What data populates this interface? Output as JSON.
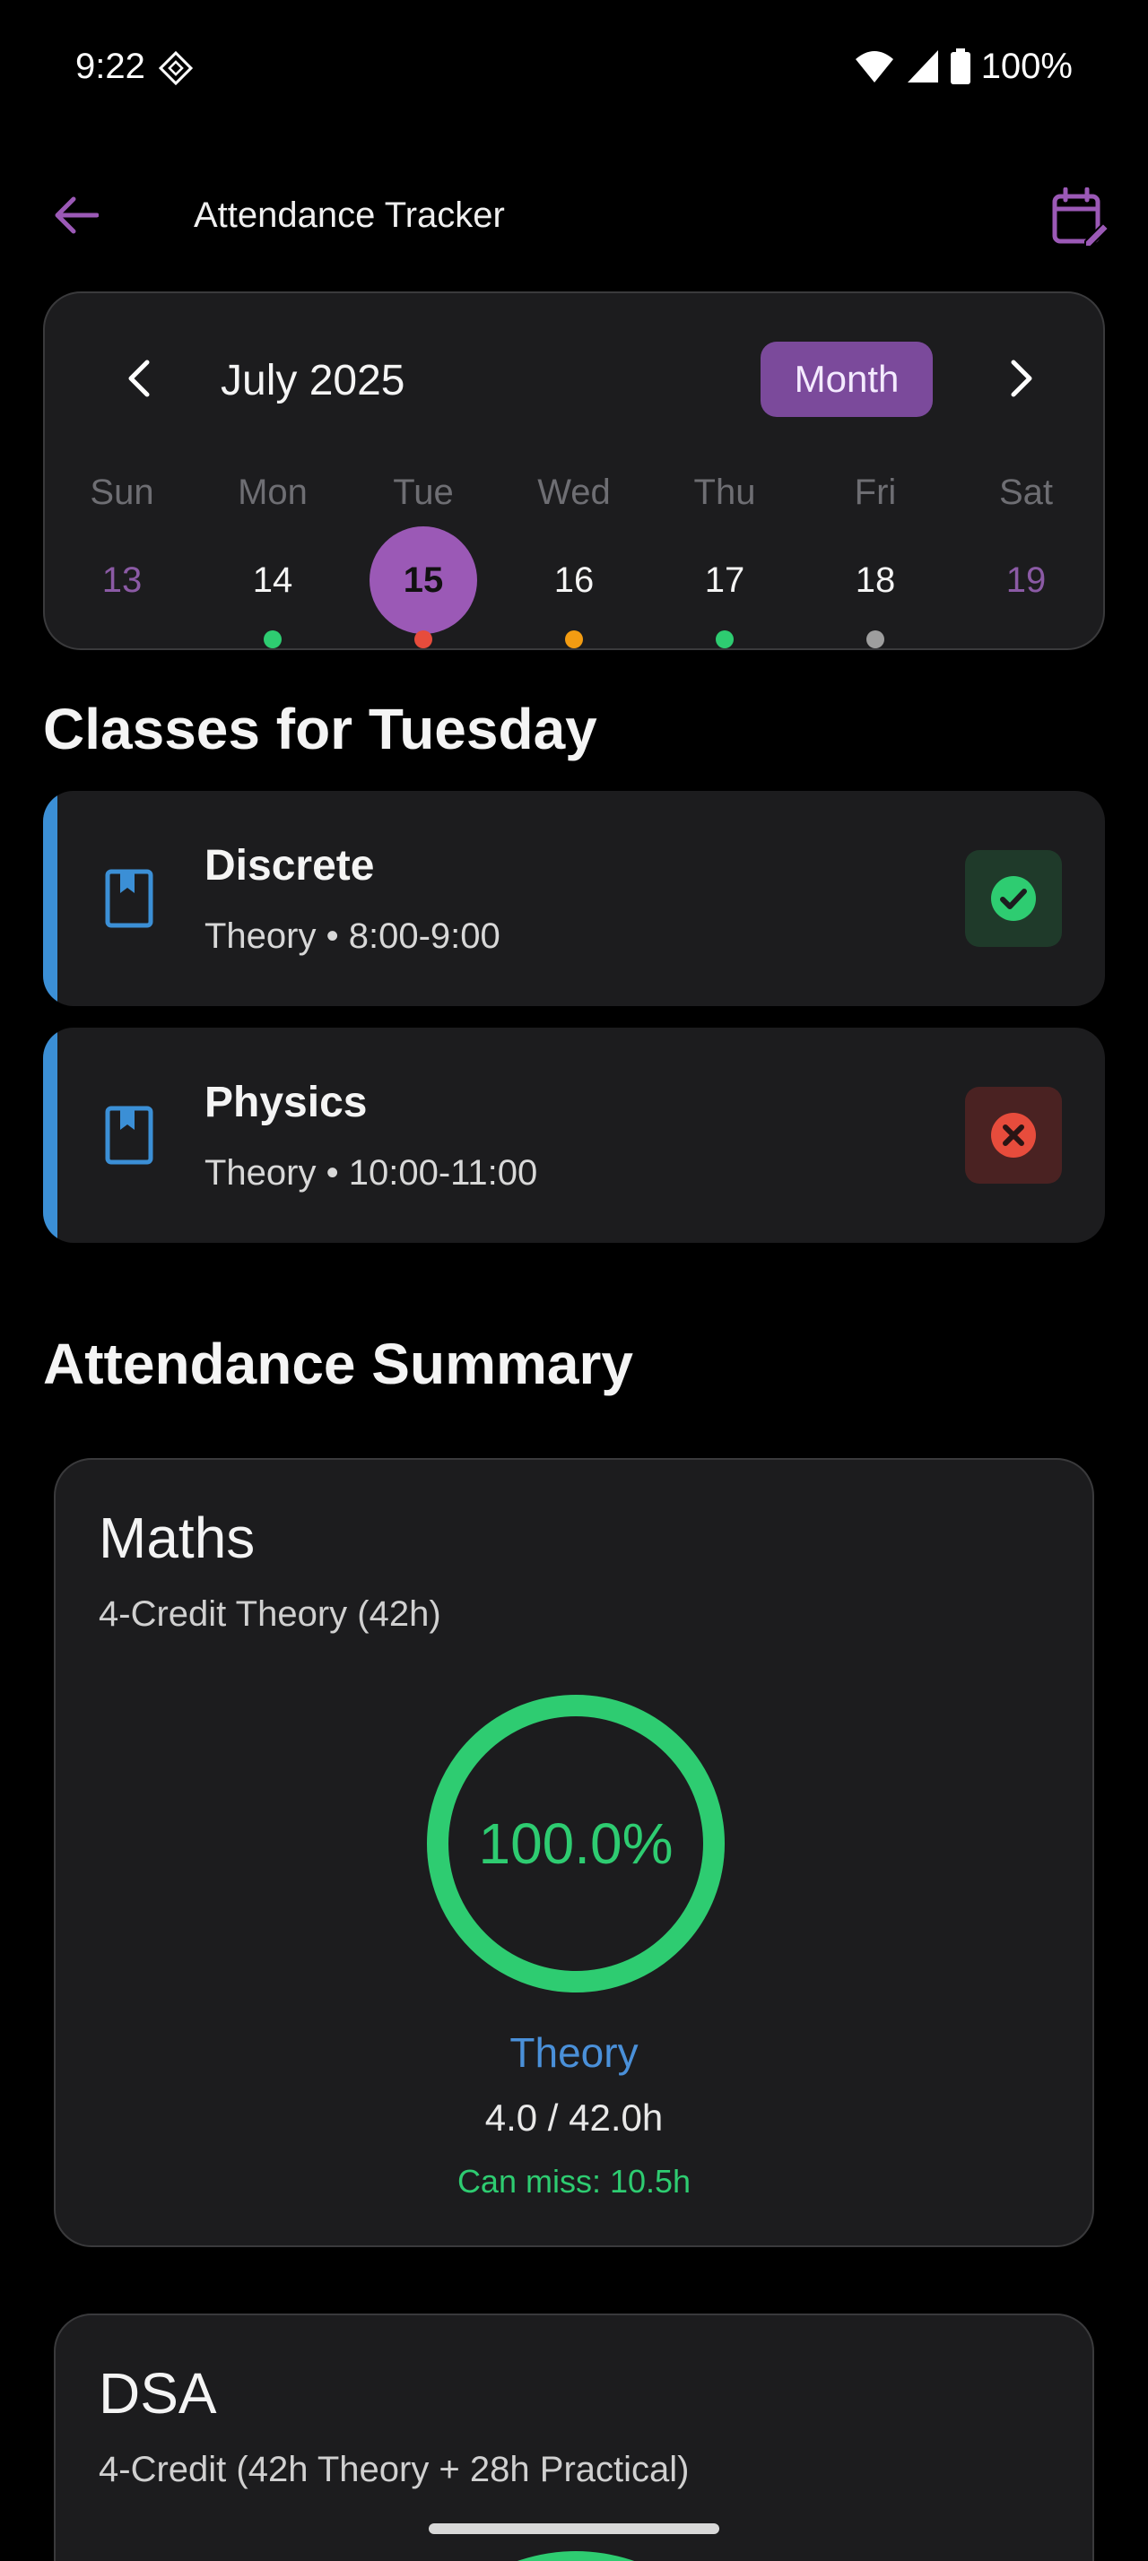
{
  "status_bar": {
    "time": "9:22",
    "battery": "100%"
  },
  "header": {
    "title": "Attendance Tracker"
  },
  "calendar": {
    "month_label": "July 2025",
    "view_button": "Month",
    "weekdays": [
      "Sun",
      "Mon",
      "Tue",
      "Wed",
      "Thu",
      "Fri",
      "Sat"
    ],
    "days": [
      "13",
      "14",
      "15",
      "16",
      "17",
      "18",
      "19"
    ],
    "selected_day": "15",
    "day_dot_colors": [
      "",
      "#2ecc71",
      "#e74c3c",
      "#f39c12",
      "#2ecc71",
      "#9e9e9e",
      ""
    ]
  },
  "classes_section": {
    "title": "Classes for Tuesday",
    "items": [
      {
        "name": "Discrete",
        "meta": "Theory • 8:00-9:00",
        "status": "present"
      },
      {
        "name": "Physics",
        "meta": "Theory • 10:00-11:00",
        "status": "absent"
      }
    ]
  },
  "summary_section": {
    "title": "Attendance Summary",
    "cards": [
      {
        "name": "Maths",
        "subtitle": "4-Credit Theory (42h)",
        "percent_label": "100.0%",
        "percent_value": 100.0,
        "component": "Theory",
        "hours": "4.0 / 42.0h",
        "can_miss": "Can miss: 10.5h"
      },
      {
        "name": "DSA",
        "subtitle": "4-Credit (42h Theory + 28h Practical)"
      }
    ]
  },
  "colors": {
    "accent": "#9b59b6",
    "present": "#2ecc71",
    "absent": "#e74c3c",
    "theory": "#4a90d9"
  }
}
